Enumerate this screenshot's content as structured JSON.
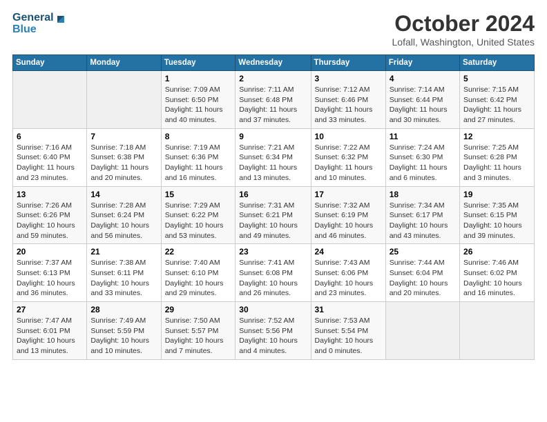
{
  "header": {
    "logo_general": "General",
    "logo_blue": "Blue",
    "month_title": "October 2024",
    "location": "Lofall, Washington, United States"
  },
  "days_of_week": [
    "Sunday",
    "Monday",
    "Tuesday",
    "Wednesday",
    "Thursday",
    "Friday",
    "Saturday"
  ],
  "weeks": [
    [
      {
        "day": "",
        "info": ""
      },
      {
        "day": "",
        "info": ""
      },
      {
        "day": "1",
        "info": "Sunrise: 7:09 AM\nSunset: 6:50 PM\nDaylight: 11 hours and 40 minutes."
      },
      {
        "day": "2",
        "info": "Sunrise: 7:11 AM\nSunset: 6:48 PM\nDaylight: 11 hours and 37 minutes."
      },
      {
        "day": "3",
        "info": "Sunrise: 7:12 AM\nSunset: 6:46 PM\nDaylight: 11 hours and 33 minutes."
      },
      {
        "day": "4",
        "info": "Sunrise: 7:14 AM\nSunset: 6:44 PM\nDaylight: 11 hours and 30 minutes."
      },
      {
        "day": "5",
        "info": "Sunrise: 7:15 AM\nSunset: 6:42 PM\nDaylight: 11 hours and 27 minutes."
      }
    ],
    [
      {
        "day": "6",
        "info": "Sunrise: 7:16 AM\nSunset: 6:40 PM\nDaylight: 11 hours and 23 minutes."
      },
      {
        "day": "7",
        "info": "Sunrise: 7:18 AM\nSunset: 6:38 PM\nDaylight: 11 hours and 20 minutes."
      },
      {
        "day": "8",
        "info": "Sunrise: 7:19 AM\nSunset: 6:36 PM\nDaylight: 11 hours and 16 minutes."
      },
      {
        "day": "9",
        "info": "Sunrise: 7:21 AM\nSunset: 6:34 PM\nDaylight: 11 hours and 13 minutes."
      },
      {
        "day": "10",
        "info": "Sunrise: 7:22 AM\nSunset: 6:32 PM\nDaylight: 11 hours and 10 minutes."
      },
      {
        "day": "11",
        "info": "Sunrise: 7:24 AM\nSunset: 6:30 PM\nDaylight: 11 hours and 6 minutes."
      },
      {
        "day": "12",
        "info": "Sunrise: 7:25 AM\nSunset: 6:28 PM\nDaylight: 11 hours and 3 minutes."
      }
    ],
    [
      {
        "day": "13",
        "info": "Sunrise: 7:26 AM\nSunset: 6:26 PM\nDaylight: 10 hours and 59 minutes."
      },
      {
        "day": "14",
        "info": "Sunrise: 7:28 AM\nSunset: 6:24 PM\nDaylight: 10 hours and 56 minutes."
      },
      {
        "day": "15",
        "info": "Sunrise: 7:29 AM\nSunset: 6:22 PM\nDaylight: 10 hours and 53 minutes."
      },
      {
        "day": "16",
        "info": "Sunrise: 7:31 AM\nSunset: 6:21 PM\nDaylight: 10 hours and 49 minutes."
      },
      {
        "day": "17",
        "info": "Sunrise: 7:32 AM\nSunset: 6:19 PM\nDaylight: 10 hours and 46 minutes."
      },
      {
        "day": "18",
        "info": "Sunrise: 7:34 AM\nSunset: 6:17 PM\nDaylight: 10 hours and 43 minutes."
      },
      {
        "day": "19",
        "info": "Sunrise: 7:35 AM\nSunset: 6:15 PM\nDaylight: 10 hours and 39 minutes."
      }
    ],
    [
      {
        "day": "20",
        "info": "Sunrise: 7:37 AM\nSunset: 6:13 PM\nDaylight: 10 hours and 36 minutes."
      },
      {
        "day": "21",
        "info": "Sunrise: 7:38 AM\nSunset: 6:11 PM\nDaylight: 10 hours and 33 minutes."
      },
      {
        "day": "22",
        "info": "Sunrise: 7:40 AM\nSunset: 6:10 PM\nDaylight: 10 hours and 29 minutes."
      },
      {
        "day": "23",
        "info": "Sunrise: 7:41 AM\nSunset: 6:08 PM\nDaylight: 10 hours and 26 minutes."
      },
      {
        "day": "24",
        "info": "Sunrise: 7:43 AM\nSunset: 6:06 PM\nDaylight: 10 hours and 23 minutes."
      },
      {
        "day": "25",
        "info": "Sunrise: 7:44 AM\nSunset: 6:04 PM\nDaylight: 10 hours and 20 minutes."
      },
      {
        "day": "26",
        "info": "Sunrise: 7:46 AM\nSunset: 6:02 PM\nDaylight: 10 hours and 16 minutes."
      }
    ],
    [
      {
        "day": "27",
        "info": "Sunrise: 7:47 AM\nSunset: 6:01 PM\nDaylight: 10 hours and 13 minutes."
      },
      {
        "day": "28",
        "info": "Sunrise: 7:49 AM\nSunset: 5:59 PM\nDaylight: 10 hours and 10 minutes."
      },
      {
        "day": "29",
        "info": "Sunrise: 7:50 AM\nSunset: 5:57 PM\nDaylight: 10 hours and 7 minutes."
      },
      {
        "day": "30",
        "info": "Sunrise: 7:52 AM\nSunset: 5:56 PM\nDaylight: 10 hours and 4 minutes."
      },
      {
        "day": "31",
        "info": "Sunrise: 7:53 AM\nSunset: 5:54 PM\nDaylight: 10 hours and 0 minutes."
      },
      {
        "day": "",
        "info": ""
      },
      {
        "day": "",
        "info": ""
      }
    ]
  ]
}
